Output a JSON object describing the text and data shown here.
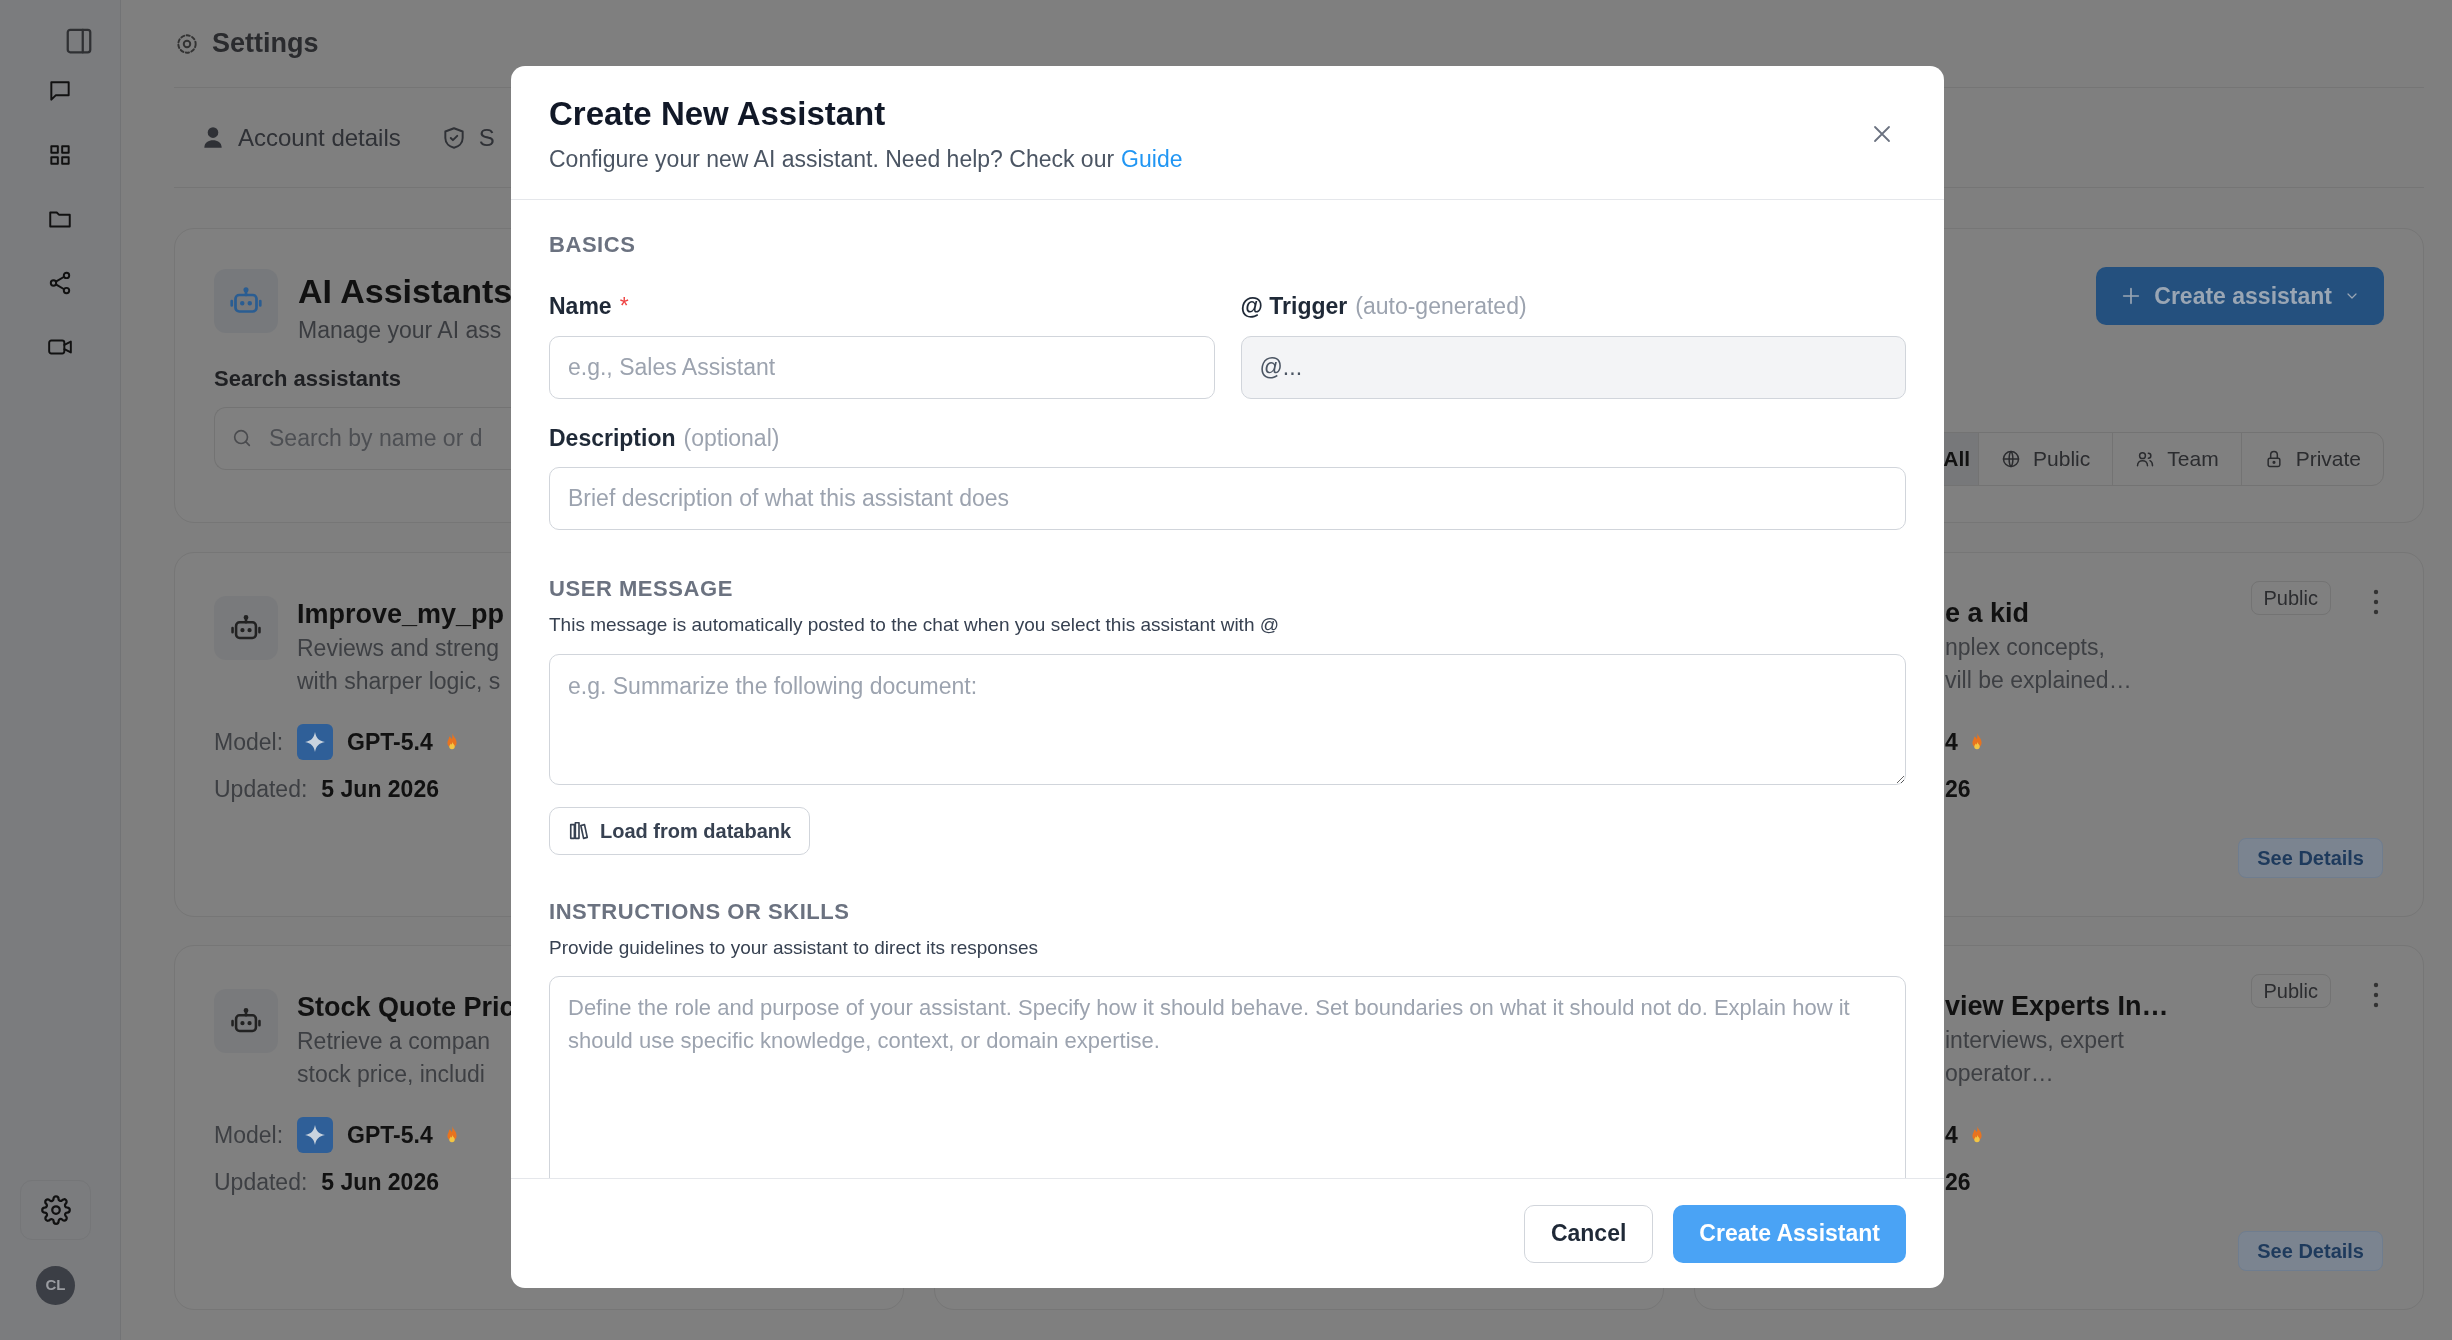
{
  "sidebar": {
    "avatar": "CL"
  },
  "header": {
    "title": "Settings"
  },
  "tabs": [
    {
      "label": "Account details"
    },
    {
      "label": "S"
    }
  ],
  "assistants_panel": {
    "title": "AI Assistants",
    "subtitle": "Manage your AI ass",
    "search_label": "Search assistants",
    "search_placeholder": "Search by name or d",
    "create_button": "Create assistant",
    "filters": [
      {
        "label": "All",
        "selected": true
      },
      {
        "label": "Public",
        "selected": false
      },
      {
        "label": "Team",
        "selected": false
      },
      {
        "label": "Private",
        "selected": false
      }
    ]
  },
  "cards": [
    {
      "kind": "left",
      "title": "Improve_my_pp",
      "description": [
        "Reviews and streng",
        "with sharper logic, s"
      ],
      "model_label": "Model:",
      "model": "GPT-5.4",
      "updated_label": "Updated:",
      "updated": "5 Jun 2026"
    },
    {
      "kind": "right",
      "badge": "Public",
      "title": "e a kid",
      "description": [
        "nplex concepts,",
        "vill be explained…"
      ],
      "model": "4",
      "updated": "26",
      "action": "See Details"
    },
    {
      "kind": "left",
      "title": "Stock Quote Pric",
      "description": [
        "Retrieve a compan",
        "stock price, includi"
      ],
      "model_label": "Model:",
      "model": "GPT-5.4",
      "updated_label": "Updated:",
      "updated": "5 Jun 2026"
    },
    {
      "kind": "right",
      "badge": "Public",
      "title": "view Experts In…",
      "description": [
        "interviews, expert",
        "operator…"
      ],
      "model": "4",
      "updated": "26",
      "action": "See Details"
    }
  ],
  "dialog": {
    "title": "Create New Assistant",
    "subtitle": "Configure your new AI assistant. Need help? Check our",
    "link": "Guide",
    "basics": {
      "heading": "BASICS",
      "name": {
        "label": "Name",
        "required_mark": "*",
        "placeholder": "e.g., Sales Assistant"
      },
      "trigger": {
        "label": "@ Trigger",
        "note": "(auto-generated)",
        "value": "@...",
        "disabled": true
      },
      "description": {
        "label": "Description",
        "note": "(optional)",
        "placeholder": "Brief description of what this assistant does"
      }
    },
    "user_message": {
      "heading": "USER MESSAGE",
      "help": "This message is automatically posted to the chat when you select this assistant with @",
      "placeholder": "e.g. Summarize the following document:",
      "load_button": "Load from databank"
    },
    "instructions": {
      "heading": "INSTRUCTIONS OR SKILLS",
      "help": "Provide guidelines to your assistant to direct its responses",
      "placeholder": "Define the role and purpose of your assistant. Specify how it should behave. Set boundaries on what it should not do. Explain how it should use specific knowledge, context, or domain expertise."
    },
    "buttons": {
      "cancel": "Cancel",
      "submit": "Create Assistant"
    }
  }
}
